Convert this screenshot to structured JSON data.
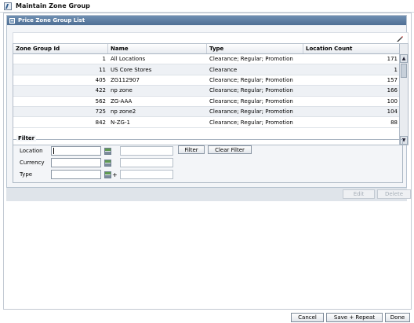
{
  "window": {
    "title": "Maintain Zone Group"
  },
  "panel": {
    "title": "Price Zone Group List"
  },
  "table": {
    "columns": [
      "Zone Group Id",
      "Name",
      "Type",
      "Location Count"
    ],
    "rows": [
      {
        "id": "1",
        "name": "All Locations",
        "type": "Clearance; Regular; Promotion",
        "count": "171"
      },
      {
        "id": "11",
        "name": "US Core Stores",
        "type": "Clearance",
        "count": "1"
      },
      {
        "id": "405",
        "name": "ZG112907",
        "type": "Clearance; Regular; Promotion",
        "count": "157"
      },
      {
        "id": "422",
        "name": "np zone",
        "type": "Clearance; Regular; Promotion",
        "count": "166"
      },
      {
        "id": "562",
        "name": "ZG-AAA",
        "type": "Clearance; Regular; Promotion",
        "count": "100"
      },
      {
        "id": "725",
        "name": "np zone2",
        "type": "Clearance; Regular; Promotion",
        "count": "104"
      },
      {
        "id": "842",
        "name": "N-ZG-1",
        "type": "Clearance; Regular; Promotion",
        "count": "88"
      }
    ]
  },
  "filter": {
    "legend": "Filter",
    "location_label": "Location",
    "currency_label": "Currency",
    "type_label": "Type",
    "plus": "+",
    "filter_button": "Filter",
    "clear_button": "Clear Filter"
  },
  "panel_actions": {
    "edit": "Edit",
    "delete": "Delete"
  },
  "footer": {
    "cancel": "Cancel",
    "save_repeat": "Save + Repeat",
    "done": "Done"
  },
  "icons": [
    "app-icon",
    "collapse-icon",
    "edit-tool-icon",
    "scroll-up-icon",
    "scroll-down-icon",
    "lookup-icon"
  ]
}
